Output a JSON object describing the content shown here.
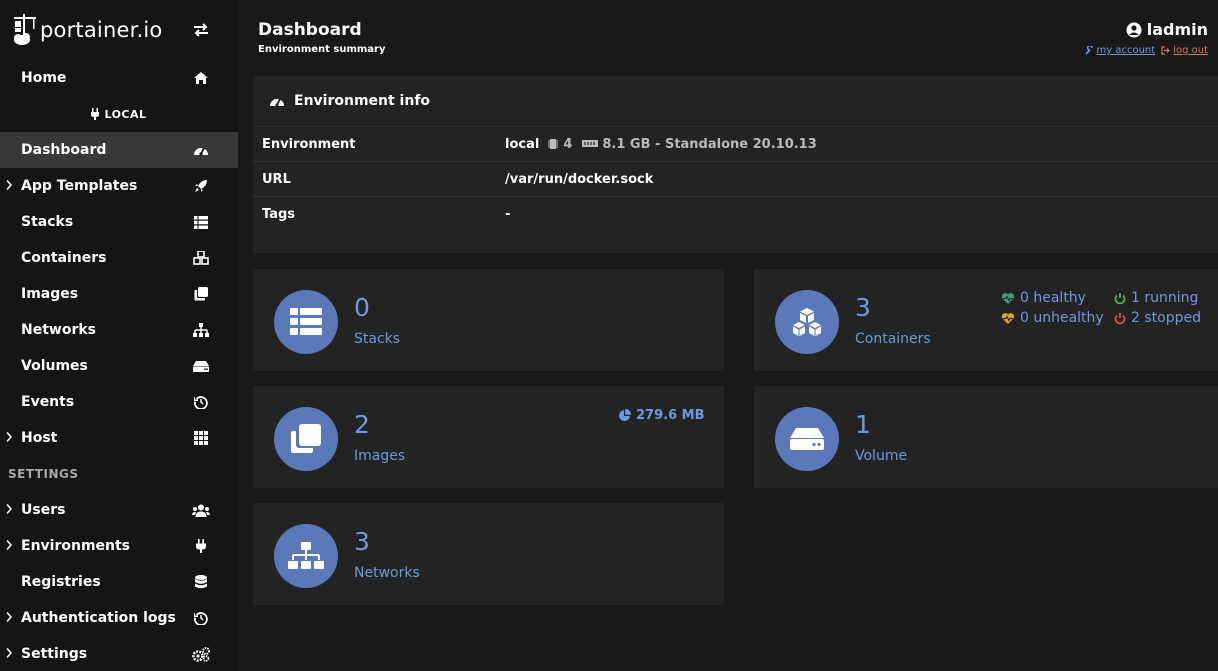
{
  "app": {
    "logo_text": "portainer.io"
  },
  "sidebar": {
    "home_label": "Home",
    "env_name": "LOCAL",
    "items": [
      {
        "label": "Dashboard",
        "icon": "tachometer-icon",
        "active": true,
        "chevron": false
      },
      {
        "label": "App Templates",
        "icon": "rocket-icon",
        "chevron": true
      },
      {
        "label": "Stacks",
        "icon": "th-list-icon",
        "chevron": false
      },
      {
        "label": "Containers",
        "icon": "cubes-icon",
        "chevron": false
      },
      {
        "label": "Images",
        "icon": "clone-icon",
        "chevron": false
      },
      {
        "label": "Networks",
        "icon": "sitemap-icon",
        "chevron": false
      },
      {
        "label": "Volumes",
        "icon": "hdd-icon",
        "chevron": false
      },
      {
        "label": "Events",
        "icon": "history-icon",
        "chevron": false
      },
      {
        "label": "Host",
        "icon": "grid-icon",
        "chevron": true
      }
    ],
    "settings_title": "SETTINGS",
    "settings_items": [
      {
        "label": "Users",
        "icon": "users-icon",
        "chevron": true
      },
      {
        "label": "Environments",
        "icon": "plug-icon",
        "chevron": true
      },
      {
        "label": "Registries",
        "icon": "database-icon",
        "chevron": false
      },
      {
        "label": "Authentication logs",
        "icon": "history-icon",
        "chevron": true
      },
      {
        "label": "Settings",
        "icon": "cogs-icon",
        "chevron": true
      }
    ]
  },
  "header": {
    "title": "Dashboard",
    "subtitle": "Environment summary",
    "username": "ladmin",
    "my_account": "my account",
    "log_out": "log out"
  },
  "env_info": {
    "title": "Environment info",
    "rows": {
      "environment_key": "Environment",
      "environment_name": "local",
      "cpu": "4",
      "memory": "8.1 GB - Standalone 20.10.13",
      "url_key": "URL",
      "url_value": "/var/run/docker.sock",
      "tags_key": "Tags",
      "tags_value": "-"
    }
  },
  "stats": {
    "stacks": {
      "count": "0",
      "label": "Stacks"
    },
    "containers": {
      "count": "3",
      "label": "Containers",
      "healthy": "0 healthy",
      "unhealthy": "0 unhealthy",
      "running": "1 running",
      "stopped": "2 stopped"
    },
    "images": {
      "count": "2",
      "label": "Images",
      "size": "279.6 MB"
    },
    "volumes": {
      "count": "1",
      "label": "Volume"
    },
    "networks": {
      "count": "3",
      "label": "Networks"
    }
  },
  "colors": {
    "accent": "#6e9be0",
    "circle": "#5b78b8",
    "healthy": "#3fa07a",
    "unhealthy": "#d4a72c",
    "running": "#5fa863",
    "stopped": "#d9534f"
  }
}
